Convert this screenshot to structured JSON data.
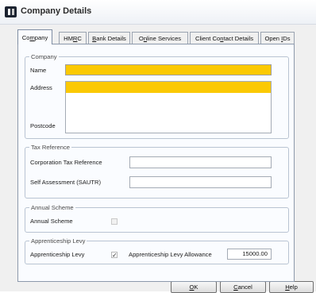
{
  "window": {
    "title": "Company Details"
  },
  "tabs": [
    {
      "pre": "Co",
      "key": "m",
      "post": "pany",
      "active": true
    },
    {
      "pre": "HM",
      "key": "R",
      "post": "C"
    },
    {
      "pre": "",
      "key": "B",
      "post": "ank Details"
    },
    {
      "pre": "O",
      "key": "n",
      "post": "line Services"
    },
    {
      "pre": "Client Co",
      "key": "n",
      "post": "tact Details"
    },
    {
      "pre": "Open ",
      "key": "I",
      "post": "Ds"
    }
  ],
  "company": {
    "legend": "Company",
    "name_label": "Name",
    "name_value": "",
    "address_label": "Address",
    "address_value": "",
    "postcode_label": "Postcode",
    "postcode_value": ""
  },
  "tax_reference": {
    "legend": "Tax Reference",
    "corporation_label": "Corporation Tax Reference",
    "corporation_value": "",
    "self_assessment_label": "Self Assessment (SAUTR)",
    "self_assessment_value": ""
  },
  "annual_scheme": {
    "legend": "Annual Scheme",
    "checkbox_label": "Annual Scheme",
    "checked": false,
    "enabled": false
  },
  "apprenticeship_levy": {
    "legend": "Apprenticeship Levy",
    "checkbox_label": "Apprenticeship Levy",
    "checked": true,
    "allowance_label": "Apprenticeship Levy Allowance",
    "allowance_value": "15000.00"
  },
  "buttons": {
    "ok": {
      "pre": "",
      "key": "O",
      "post": "K"
    },
    "cancel": {
      "pre": "",
      "key": "C",
      "post": "ancel"
    },
    "help": {
      "pre": "",
      "key": "H",
      "post": "elp"
    }
  },
  "colors": {
    "required_field": "#fbc903",
    "panel": "#fafcff",
    "window": "#f0f0f0"
  }
}
